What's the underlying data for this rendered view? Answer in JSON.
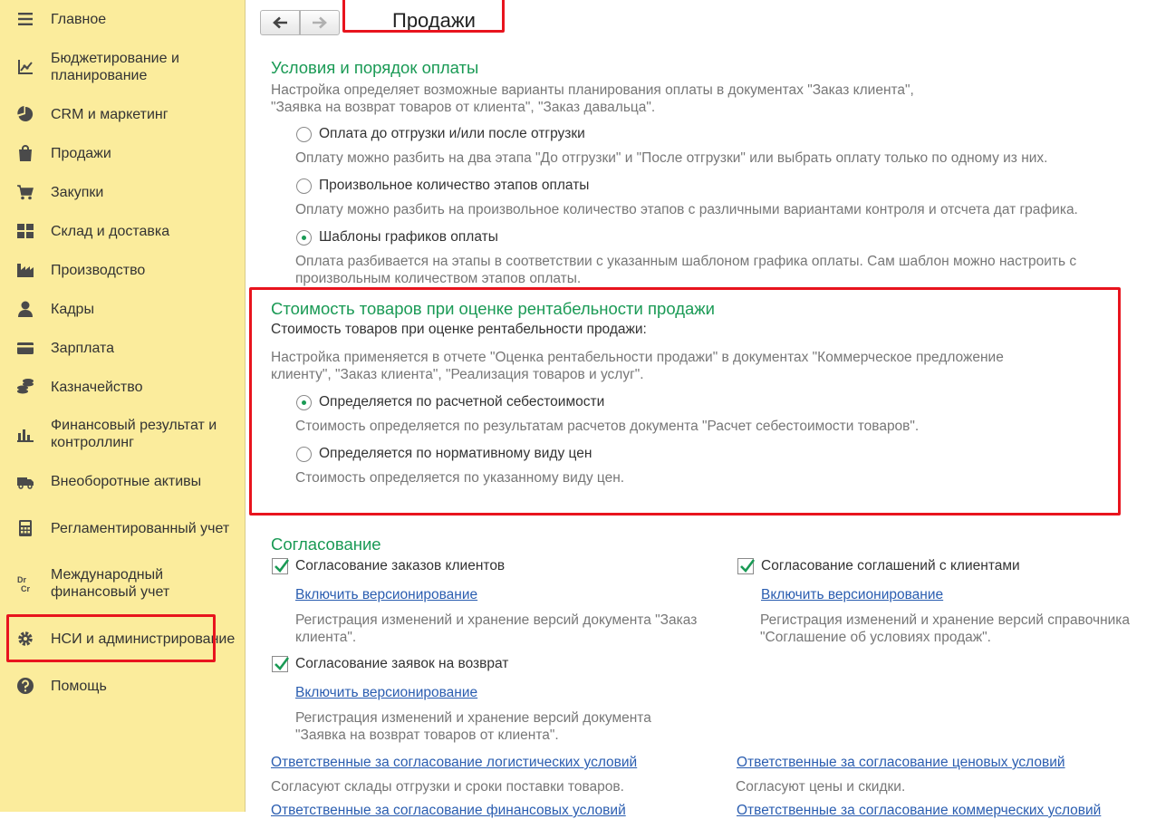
{
  "sidebar": {
    "items": [
      {
        "label": "Главное",
        "icon": "menu-icon"
      },
      {
        "label": "Бюджетирование и планирование",
        "icon": "budget-chart-icon"
      },
      {
        "label": "CRM и маркетинг",
        "icon": "pie-chart-icon"
      },
      {
        "label": "Продажи",
        "icon": "shopping-bag-icon"
      },
      {
        "label": "Закупки",
        "icon": "cart-icon"
      },
      {
        "label": "Склад и доставка",
        "icon": "warehouse-grid-icon"
      },
      {
        "label": "Производство",
        "icon": "factory-icon"
      },
      {
        "label": "Кадры",
        "icon": "person-icon"
      },
      {
        "label": "Зарплата",
        "icon": "card-icon"
      },
      {
        "label": "Казначейство",
        "icon": "coins-icon"
      },
      {
        "label": "Финансовый результат и контроллинг",
        "icon": "bar-chart-icon"
      },
      {
        "label": "Внеоборотные активы",
        "icon": "truck-icon"
      },
      {
        "label": "Регламентированный учет",
        "icon": "calculator-icon"
      },
      {
        "label": "Международный финансовый учет",
        "icon": "dr-cr-icon"
      },
      {
        "label": "НСИ и администрирование",
        "icon": "gear-icon"
      },
      {
        "label": "Помощь",
        "icon": "help-icon"
      }
    ],
    "dr_text": "Dr",
    "cr_text": "Cr"
  },
  "toolbar": {
    "back_icon": "arrow-left-icon",
    "forward_icon": "arrow-right-icon"
  },
  "page_title": "Продажи",
  "payment": {
    "title": "Условия и порядок оплаты",
    "desc1": "Настройка определяет возможные варианты планирования оплаты в документах \"Заказ клиента\",",
    "desc2": "\"Заявка на возврат товаров от клиента\", \"Заказ давальца\".",
    "options": [
      {
        "label": "Оплата до отгрузки и/или после отгрузки",
        "selected": false,
        "desc": "Оплату можно разбить на два этапа \"До отгрузки\" и \"После отгрузки\" или выбрать оплату только по одному из них."
      },
      {
        "label": "Произвольное количество этапов оплаты",
        "selected": false,
        "desc": "Оплату можно разбить на произвольное количество этапов с различными вариантами контроля и отсчета дат графика."
      },
      {
        "label": "Шаблоны графиков оплаты",
        "selected": true,
        "desc1": "Оплата разбивается на этапы в соответствии с указанным шаблоном графика оплаты. Сам шаблон можно настроить с",
        "desc2": "произвольным количеством этапов оплаты."
      }
    ]
  },
  "cost": {
    "title": "Стоимость товаров при оценке рентабельности продажи",
    "subtitle": "Стоимость товаров при оценке рентабельности продажи:",
    "desc1": "Настройка применяется в отчете \"Оценка рентабельности продажи\" в документах \"Коммерческое предложение",
    "desc2": "клиенту\", \"Заказ клиента\", \"Реализация товаров и услуг\".",
    "options": [
      {
        "label": "Определяется по расчетной себестоимости",
        "selected": true,
        "desc": "Стоимость определяется по результатам расчетов документа \"Расчет себестоимости товаров\"."
      },
      {
        "label": "Определяется по нормативному виду цен",
        "selected": false,
        "desc": "Стоимость определяется по указанному виду цен."
      }
    ]
  },
  "approval": {
    "title": "Согласование",
    "orders": {
      "label": "Согласование заказов клиентов",
      "checked": true,
      "link": "Включить версионирование",
      "desc1": "Регистрация изменений и хранение версий документа \"Заказ",
      "desc2": "клиента\"."
    },
    "agreements": {
      "label": "Согласование соглашений с клиентами",
      "checked": true,
      "link": "Включить версионирование",
      "desc1": "Регистрация изменений и хранение версий справочника",
      "desc2": "\"Соглашение об условиях продаж\"."
    },
    "returns": {
      "label": "Согласование заявок на возврат",
      "checked": true,
      "link": "Включить версионирование",
      "desc1": "Регистрация изменений и хранение версий документа",
      "desc2": "\"Заявка на возврат товаров от клиента\"."
    },
    "logistics_link": "Ответственные за согласование логистических условий",
    "logistics_desc": "Согласуют склады отгрузки и сроки поставки товаров.",
    "price_link": "Ответственные за согласование ценовых условий",
    "price_desc": "Согласуют цены и скидки.",
    "financial_link": "Ответственные за согласование финансовых условий",
    "commercial_link": "Ответственные за согласование коммерческих условий"
  },
  "colors": {
    "accent_green": "#1a9a55",
    "sidebar_bg": "#fbec9c",
    "highlight_red": "#e8141e",
    "link_blue": "#2a5db0"
  }
}
